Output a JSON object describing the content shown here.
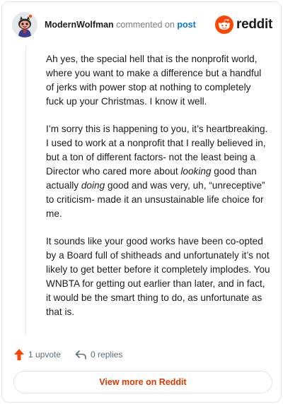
{
  "header": {
    "username": "ModernWolfman",
    "action_text": "commented on",
    "target_text": "post",
    "brand_name": "reddit"
  },
  "comment": {
    "p1": "Ah yes, the special hell that is the nonprofit world, where you want to make a difference but a handful of jerks with power stop at nothing to completely fuck up your Christmas. I know it well.",
    "p2_a": "I’m sorry this is happening to you, it’s heartbreaking. I used to work at a nonprofit that I really believed in, but a ton of different factors- not the least being a Director who cared more about ",
    "p2_em1": "looking",
    "p2_b": " good than actually ",
    "p2_em2": "doing",
    "p2_c": " good and was very, uh, “unreceptive” to criticism- made it an unsustainable life choice for me.",
    "p3": "It sounds like your good works have been co-opted by a Board full of shitheads and unfortunately it’s not likely to get better before it completely implodes. You WNBTA for getting out earlier than later, and in fact, it would be the smart thing to do, as unfortunate as that is."
  },
  "actions": {
    "upvote_label": "1 upvote",
    "replies_label": "0 replies"
  },
  "footer": {
    "view_more_label": "View more on Reddit"
  },
  "icons": {
    "avatar": "snoo-avatar-icon",
    "brand": "reddit-logo-icon",
    "upvote": "upvote-arrow-icon",
    "reply": "reply-arrow-icon"
  },
  "colors": {
    "accent": "#ff4500",
    "link": "#0079d3",
    "view_more": "#d93a00",
    "muted": "#576f76"
  }
}
